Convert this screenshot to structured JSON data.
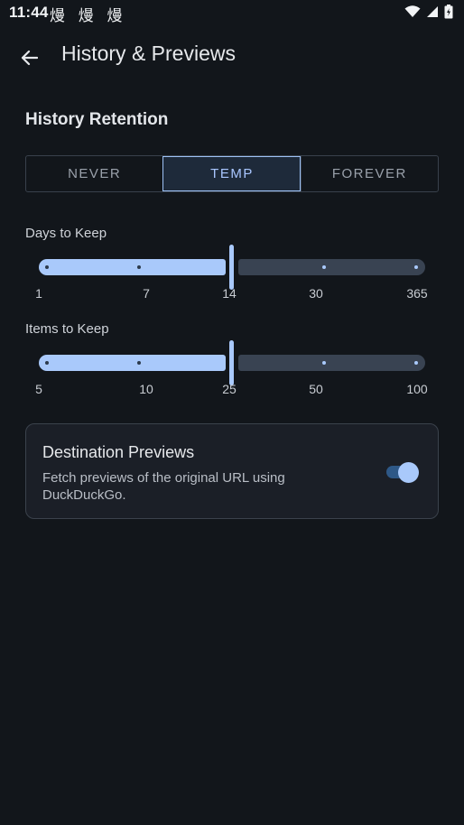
{
  "status_bar": {
    "time": "11:44",
    "notification_glyphs": "熳 熳 熳",
    "icons": [
      "wifi-icon",
      "cell-signal-icon",
      "battery-icon"
    ]
  },
  "app_bar": {
    "title": "History & Previews",
    "back_icon": "arrow-left-icon"
  },
  "history_retention": {
    "title": "History Retention",
    "options": [
      "NEVER",
      "TEMP",
      "FOREVER"
    ],
    "selected": "TEMP"
  },
  "days_to_keep": {
    "label": "Days to Keep",
    "ticks": [
      "1",
      "7",
      "14",
      "30",
      "365"
    ],
    "value": "14"
  },
  "items_to_keep": {
    "label": "Items to Keep",
    "ticks": [
      "5",
      "10",
      "25",
      "50",
      "100"
    ],
    "value": "25"
  },
  "destination_previews": {
    "title": "Destination Previews",
    "description": "Fetch previews of the original URL using DuckDuckGo.",
    "enabled": true
  },
  "colors": {
    "background": "#12161b",
    "accent": "#a9c9fb",
    "segment_active_bg": "#1e2a3a",
    "card_bg": "#1b1f27",
    "toggle_track": "#2e5887"
  }
}
